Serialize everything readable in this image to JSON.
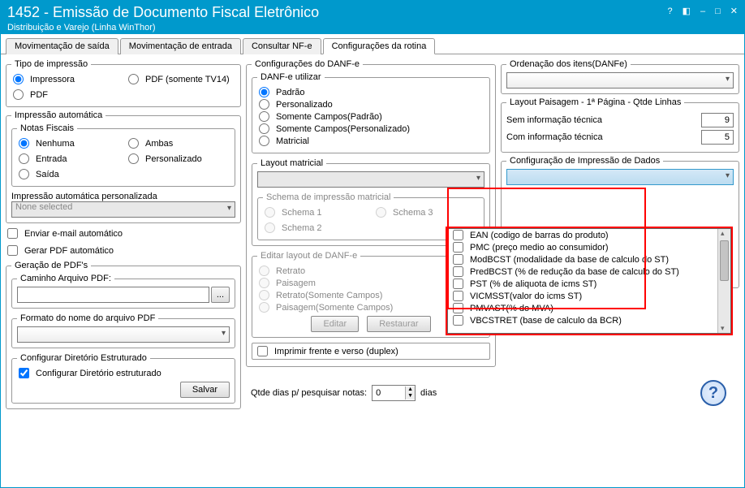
{
  "window": {
    "title": "1452 - Emissão de Documento Fiscal Eletrônico",
    "subtitle": "Distribuição e Varejo (Linha WinThor)"
  },
  "tabs": [
    "Movimentação de saída",
    "Movimentação de entrada",
    "Consultar NF-e",
    "Configurações da rotina"
  ],
  "left": {
    "tipo_impressao": {
      "legend": "Tipo de impressão",
      "options": {
        "impressora": "Impressora",
        "pdf_tv14": "PDF (somente TV14)",
        "pdf": "PDF"
      }
    },
    "impressao_auto": {
      "legend": "Impressão automática",
      "nf_legend": "Notas Fiscais",
      "options": {
        "nenhuma": "Nenhuma",
        "ambas": "Ambas",
        "entrada": "Entrada",
        "personalizado": "Personalizado",
        "saida": "Saída"
      },
      "pers_label": "Impressão automática personalizada",
      "pers_value": "None selected"
    },
    "email_auto": "Enviar e-mail automático",
    "gerar_pdf_auto": "Gerar PDF automático",
    "geracao_pdf": {
      "legend": "Geração de PDF's",
      "caminho_legend": "Caminho Arquivo PDF:",
      "formato_legend": "Formato do nome do arquivo PDF",
      "dir_legend": "Configurar Diretório Estruturado",
      "dir_check": "Configurar Diretório estruturado",
      "salvar": "Salvar"
    }
  },
  "mid": {
    "config_danfe": {
      "legend": "Configurações do DANF-e",
      "utilizar_legend": "DANF-e utilizar",
      "options": {
        "padrao": "Padrão",
        "personalizado": "Personalizado",
        "somente_padrao": "Somente Campos(Padrão)",
        "somente_pers": "Somente Campos(Personalizado)",
        "matricial": "Matricial"
      },
      "layout_matricial": "Layout matricial",
      "schema_legend": "Schema de impressão matricial",
      "schema1": "Schema 1",
      "schema2": "Schema 2",
      "schema3": "Schema 3",
      "editar_legend": "Editar layout de DANF-e",
      "retrato": "Retrato",
      "paisagem": "Paisagem",
      "retrato_sc": "Retrato(Somente Campos)",
      "paisagem_sc": "Paisagem(Somente Campos)",
      "editar": "Editar",
      "restaurar": "Restaurar",
      "duplex": "Imprimir frente e verso (duplex)"
    }
  },
  "right": {
    "ordenacao_legend": "Ordenação dos itens(DANFe)",
    "layout_paisagem_legend": "Layout Paisagem - 1ª Página - Qtde Linhas",
    "sem_info": "Sem informação técnica",
    "sem_info_val": "9",
    "com_info": "Com informação técnica",
    "com_info_val": "5",
    "config_impr_legend": "Configuração de Impressão de Dados",
    "dropdown_items": [
      "EAN (codigo de barras do produto)",
      "PMC (preço medio ao consumidor)",
      "ModBCST (modalidade da base de calculo do ST)",
      "PredBCST (% de redução da base de calculo do ST)",
      "PST (% de aliquota de icms ST)",
      "VICMSST(valor do icms ST)",
      "PMVAST(% do MVA)",
      "VBCSTRET (base de calculo da BCR)"
    ]
  },
  "bottom": {
    "qtde_label": "Qtde dias p/ pesquisar notas:",
    "qtde_val": "0",
    "dias": "dias"
  }
}
